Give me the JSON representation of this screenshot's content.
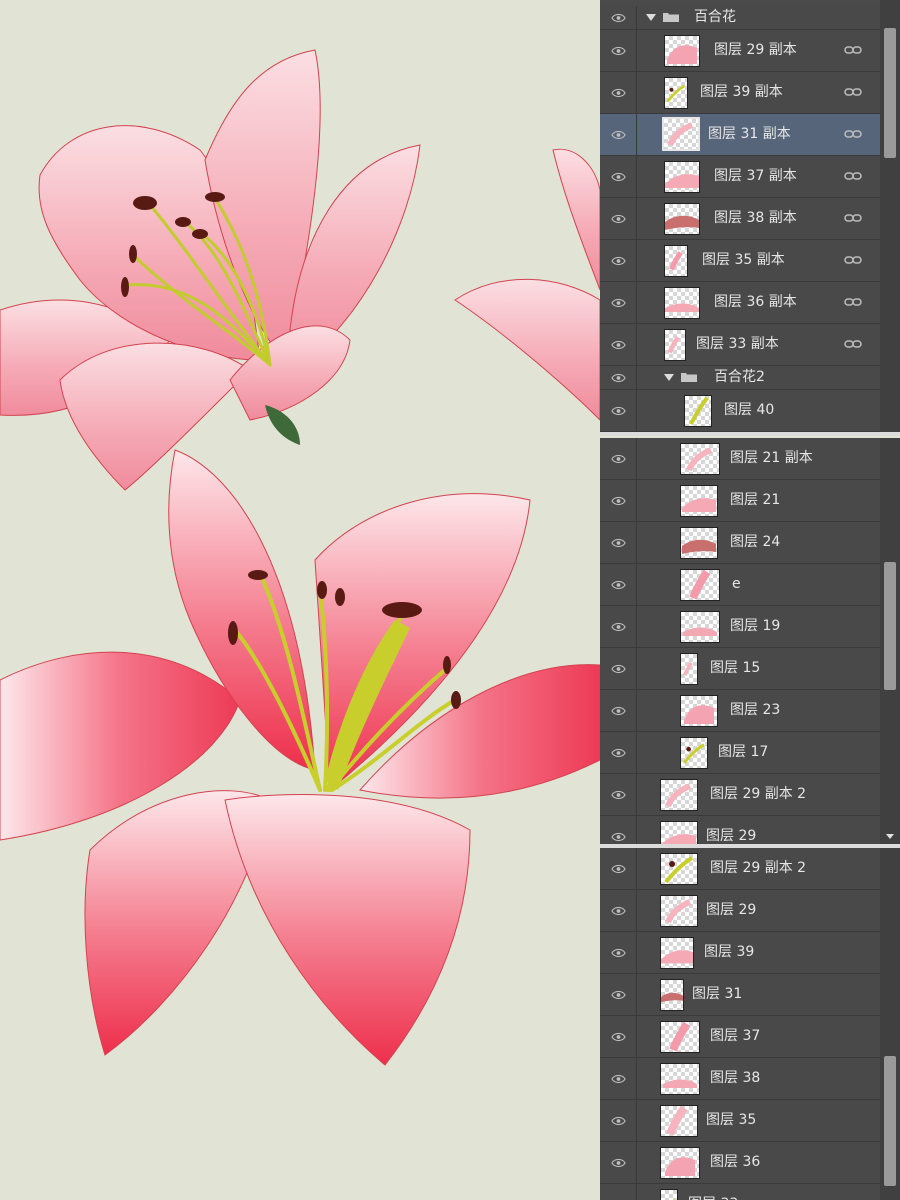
{
  "colors": {
    "canvas_bg": "#e1e3d5",
    "panel_bg": "#494949",
    "selected_row": "#56657a",
    "petal_pink": "#f4a7b3",
    "petal_red": "#ee3f59",
    "stamen_green": "#c9d23a",
    "anther_brown": "#5a1a14"
  },
  "icons": {
    "visibility": "eye-icon",
    "link": "link-icon",
    "folder": "folder-icon",
    "expand": "triangle-down-icon"
  },
  "panel_top": {
    "group": {
      "label": "百合花"
    },
    "layers": [
      {
        "label": "图层 29 副本",
        "linked": true
      },
      {
        "label": "图层 39 副本",
        "linked": true
      },
      {
        "label": "图层 31 副本",
        "linked": true,
        "selected": true
      },
      {
        "label": "图层 37 副本",
        "linked": true
      },
      {
        "label": "图层 38 副本",
        "linked": true
      },
      {
        "label": "图层 35 副本",
        "linked": true
      },
      {
        "label": "图层 36 副本",
        "linked": true
      },
      {
        "label": "图层 33 副本",
        "linked": true
      }
    ],
    "subgroup": {
      "label": "百合花2"
    },
    "sublayers": [
      {
        "label": "图层 40"
      }
    ]
  },
  "panel_middle": {
    "layers": [
      {
        "label": "图层 21 副本"
      },
      {
        "label": "图层 21"
      },
      {
        "label": "图层 24"
      },
      {
        "label": "e"
      },
      {
        "label": "图层 19"
      },
      {
        "label": "图层 15"
      },
      {
        "label": "图层 23"
      },
      {
        "label": "图层 17"
      },
      {
        "label": "图层 29 副本 2"
      },
      {
        "label": "图层 29"
      }
    ]
  },
  "panel_bottom": {
    "layers": [
      {
        "label": "图层 29 副本 2"
      },
      {
        "label": "图层 29"
      },
      {
        "label": "图层 39"
      },
      {
        "label": "图层 31"
      },
      {
        "label": "图层 37"
      },
      {
        "label": "图层 38"
      },
      {
        "label": "图层 35"
      },
      {
        "label": "图层 36"
      },
      {
        "label": "图层 33"
      }
    ]
  }
}
